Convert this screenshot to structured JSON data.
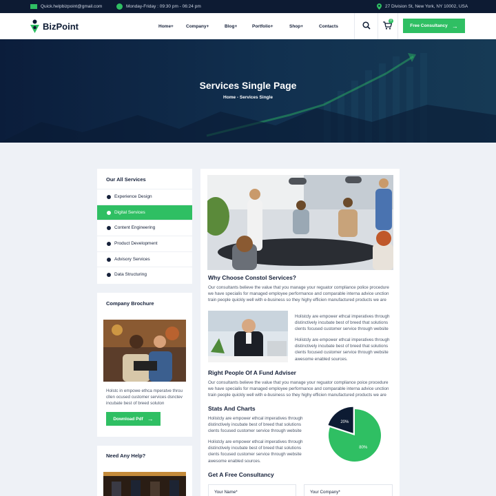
{
  "topbar": {
    "email": "Quick.helpbizpoint@gmail.com",
    "hours": "Monday-Friday : 09:30 pm - 06:24 pm",
    "address": "27 Division St, New York, NY 10002, USA"
  },
  "header": {
    "logo": "BizPoint",
    "nav": [
      "Home+",
      "Company+",
      "Blog+",
      "Portfolio+",
      "Shop+",
      "Contacts"
    ],
    "cart_count": "0",
    "cta": "Free Consultancy"
  },
  "hero": {
    "title": "Services Single Page",
    "breadcrumb": "Home - Services Single"
  },
  "sidebar": {
    "services_title": "Our All Services",
    "services": [
      "Experience Design",
      "Digital Services",
      "Content Engineering",
      "Product Development",
      "Advisory Services",
      "Data Structuring"
    ],
    "active_index": 1,
    "brochure_title": "Company Brochure",
    "brochure_text": [
      "Holstc in empowe ethca mperatve throu",
      "cllen ocused customer services dsnctev",
      "incubate best of breed soluton"
    ],
    "download_label": "Download Pdf",
    "help_title": "Need Any Help?"
  },
  "main": {
    "why_title": "Why Choose Constol Services?",
    "why_text": [
      "Our consultants believe the value that you manage your reguator compliance police procedure",
      "we have specialis for managed employee performance and comparable interna advice unction",
      "train people quickly well with e-business so they highy efficien manufactured products we are"
    ],
    "side_text_1": [
      "Holistcly are empower ethcal imperatives through",
      "distinctively incubate best of breed that solutions",
      "clents focused customer service through website"
    ],
    "side_text_2": [
      "Holistcly are empower ethcal imperatives through",
      "distinctively incubate best of breed that solutions",
      "clents focused customer service through website",
      "awesome enabled sources."
    ],
    "fund_title": "Right People Of A Fund Adviser",
    "fund_text": [
      "Our consultants believe the value that you manage your reguator compliance poice procedure",
      "we have specialis for managed employee performance and comparable interna advice unction",
      "train people quickly well with e-business so they highy efficien manufactured products we are"
    ],
    "stats_title": "Stats And Charts",
    "stats_text_1": [
      "Holistcly are empower ethcal imperatives through",
      "distinctively incubate best of breed that solutions",
      "clents focused customer service through website"
    ],
    "stats_text_2": [
      "Holistcly are empower ethcal imperatives through",
      "distinctively incubate best of breed that solutions",
      "clents focused customer service through website",
      "awesome enabled sources."
    ],
    "consult_title": "Get A Free Consultancy",
    "name_placeholder": "Your Name*",
    "company_placeholder": "Your Company*"
  },
  "chart_data": {
    "type": "pie",
    "values": [
      20,
      80
    ],
    "labels": [
      "20%",
      "80%"
    ],
    "colors": [
      "#0d1b33",
      "#2fbf63"
    ]
  },
  "colors": {
    "accent": "#2fbf63",
    "dark": "#0d1b33"
  }
}
